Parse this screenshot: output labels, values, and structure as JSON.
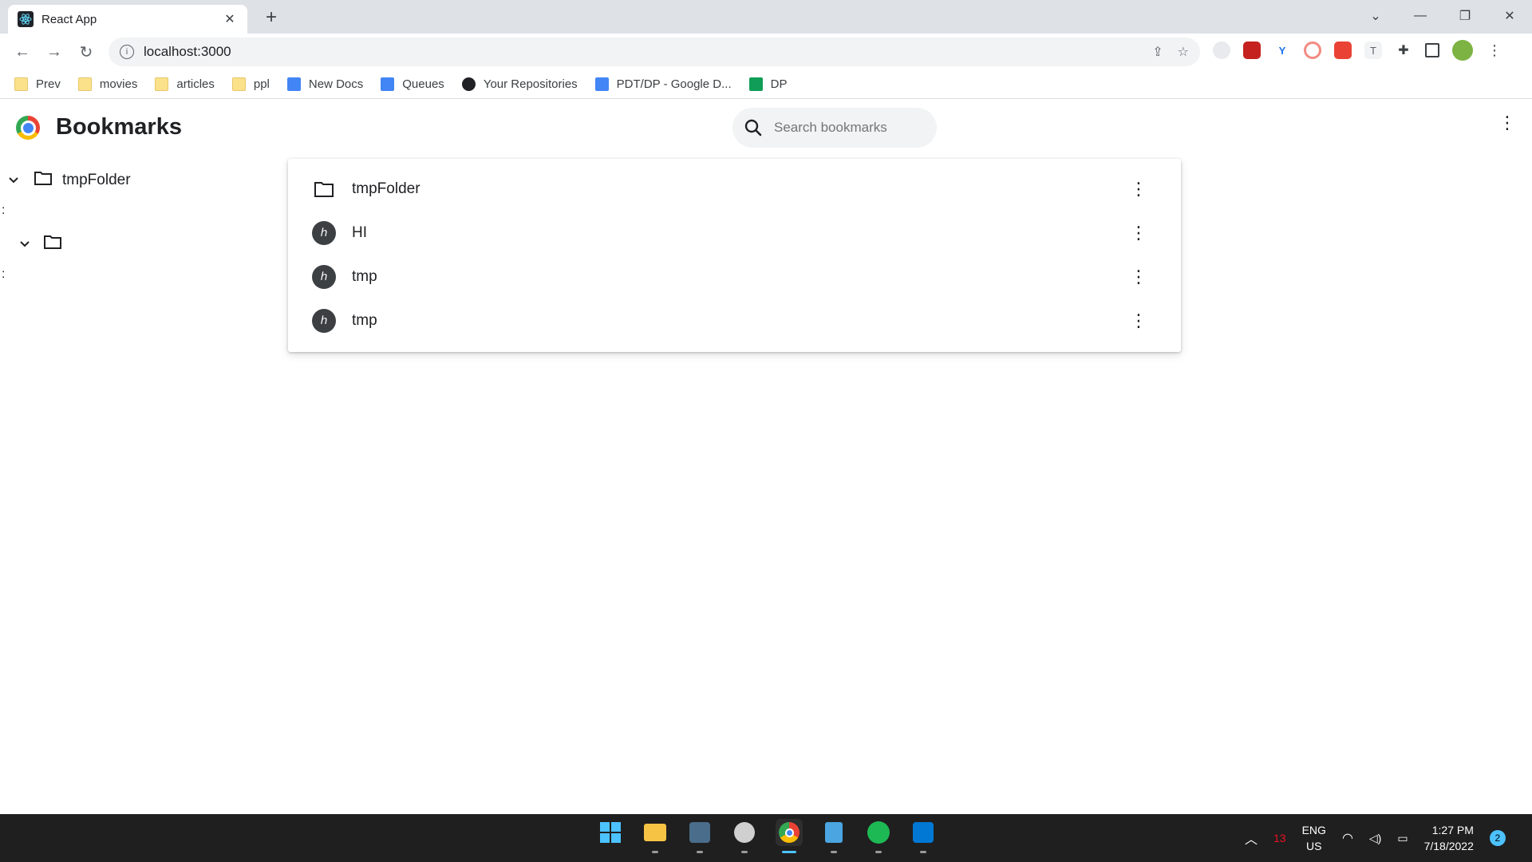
{
  "browser": {
    "tab_title": "React App",
    "url": "localhost:3000",
    "bookmarks_bar": [
      {
        "label": "Prev",
        "icon": "folder-icon"
      },
      {
        "label": "movies",
        "icon": "folder-icon"
      },
      {
        "label": "articles",
        "icon": "folder-icon"
      },
      {
        "label": "ppl",
        "icon": "folder-icon"
      },
      {
        "label": "New Docs",
        "icon": "docs-icon"
      },
      {
        "label": "Queues",
        "icon": "docs-icon"
      },
      {
        "label": "Your Repositories",
        "icon": "github-icon"
      },
      {
        "label": "PDT/DP - Google D...",
        "icon": "docs-icon"
      },
      {
        "label": "DP",
        "icon": "sheets-icon"
      }
    ]
  },
  "page": {
    "title": "Bookmarks",
    "search_placeholder": "Search bookmarks"
  },
  "tree": {
    "items": [
      {
        "label": "tmpFolder"
      },
      {
        "label": ""
      }
    ],
    "colon": ":"
  },
  "list": {
    "rows": [
      {
        "label": "tmpFolder",
        "type": "folder"
      },
      {
        "label": "HI",
        "type": "bookmark"
      },
      {
        "label": "tmp",
        "type": "bookmark"
      },
      {
        "label": "tmp",
        "type": "bookmark"
      }
    ]
  },
  "taskbar": {
    "battery_count": "13",
    "lang_line1": "ENG",
    "lang_line2": "US",
    "time": "1:27 PM",
    "date": "7/18/2022",
    "notifications": "2"
  },
  "colors": {
    "accent": "#4cc2ff",
    "chrome_frame": "#dee1e6",
    "taskbar": "#1f1f1f"
  }
}
